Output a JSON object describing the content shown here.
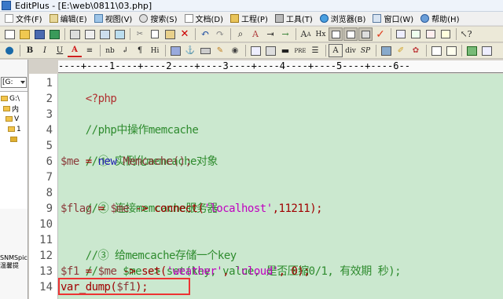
{
  "window": {
    "title": "EditPlus - [E:\\web\\0811\\03.php]"
  },
  "menu": [
    {
      "label": "文件(F)"
    },
    {
      "label": "编辑(E)"
    },
    {
      "label": "视图(V)"
    },
    {
      "label": "搜索(S)"
    },
    {
      "label": "文档(D)"
    },
    {
      "label": "工程(P)"
    },
    {
      "label": "工具(T)"
    },
    {
      "label": "浏览器(B)"
    },
    {
      "label": "窗口(W)"
    },
    {
      "label": "帮助(H)"
    }
  ],
  "toolbar2": {
    "bold": "B",
    "italic": "I",
    "underline": "U",
    "font_color": "A",
    "nbsp": "nb",
    "br": "↲",
    "para": "¶",
    "heading": "Hi",
    "pre": "PRE",
    "div": "div",
    "sp": "SP",
    "font_a": "A",
    "hx": "Hx"
  },
  "sidebar": {
    "drive": "[G:",
    "tree": [
      {
        "label": "G:\\"
      },
      {
        "label": "内"
      },
      {
        "label": "V"
      },
      {
        "label": "1"
      },
      {
        "label": ""
      }
    ],
    "bottom1": "SNMSpic",
    "bottom2": "温馨提"
  },
  "ruler": {
    "text": "----+----1----+----2----+----3----+----4----+----5----+----6--"
  },
  "editor": {
    "line_numbers": [
      "1",
      "2",
      "3",
      "4",
      "5",
      "6",
      "7",
      "8",
      "9",
      "10",
      "11",
      "12",
      "13",
      "14"
    ],
    "lines": [
      {
        "tag": "<?php"
      },
      {},
      {
        "comment": "//php中操作memcache"
      },
      {},
      {
        "comment": "//① 实例化memcache对象"
      },
      {
        "var": "$me",
        "op1": " = ",
        "kw": "new",
        "cls": " Memcache();"
      },
      {},
      {
        "comment": "//② 连接memcache服务器"
      },
      {
        "var": "$flag",
        "op1": " = ",
        "var2": "$me",
        "op2": " -> ",
        "fn": "connect(",
        "str": "'localhost'",
        "rest": ",11211);"
      },
      {},
      {
        "comment": "//③ 给memcache存储一个key"
      },
      {
        "comment": "//    $me -> set(key, value, 是否压缩0/1, 有效期 秒);"
      },
      {
        "var": "$f1",
        "op1": " = ",
        "var2": "$me",
        "op2": " -> ",
        "fn": "set(",
        "str": "'weather'",
        "mid": ", ",
        "str2": "'cloud'",
        "rest": ", 0);"
      },
      {
        "fn": "var_dump(",
        "var": "$f1",
        "rest": ");"
      }
    ]
  }
}
